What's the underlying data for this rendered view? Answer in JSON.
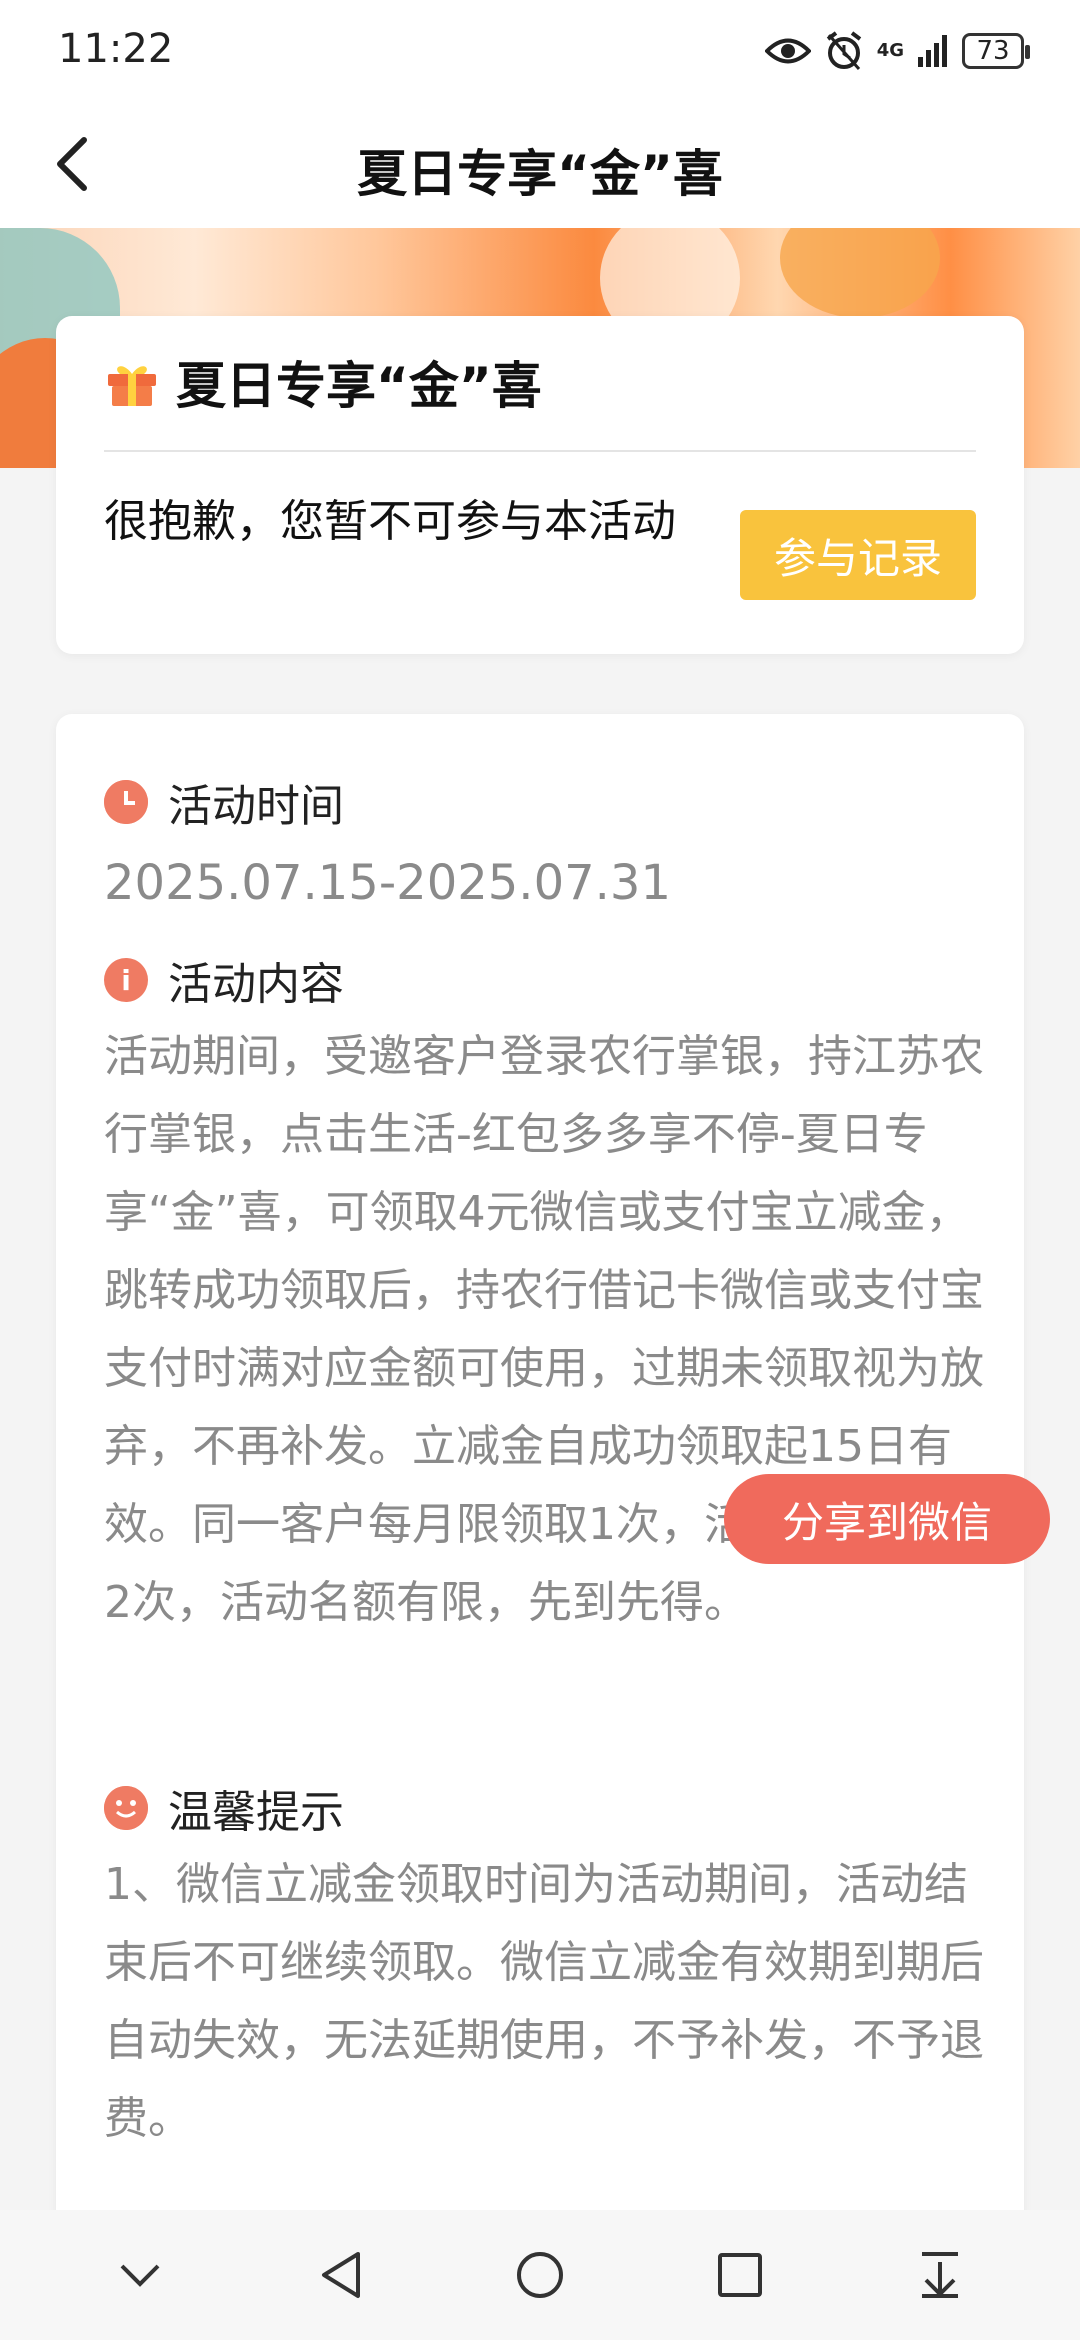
{
  "status_bar": {
    "time": "11:22",
    "network": "4G",
    "battery": "73"
  },
  "title_bar": {
    "title": "夏日专享“金”喜"
  },
  "header_card": {
    "title": "夏日专享“金”喜",
    "notice": "很抱歉，您暂不可参与本活动",
    "records_button": "参与记录"
  },
  "sections": {
    "time": {
      "heading": "活动时间",
      "content": "2025.07.15-2025.07.31"
    },
    "content": {
      "heading": "活动内容",
      "text": "活动期间，受邀客户登录农行掌银，持江苏农行掌银，点击生活-红包多多享不停-夏日专享“金”喜，可领取4元微信或支付宝立减金，跳转成功领取后，持农行借记卡微信或支付宝支付时满对应金额可使用，过期未领取视为放弃，不再补发。立减金自成功领取起15日有效。同一客户每月限领取1次，活动期内限领2次，活动名额有限，先到先得。"
    },
    "tips": {
      "heading": "温馨提示",
      "text": "1、微信立减金领取时间为活动期间，活动结束后不可继续领取。微信立减金有效期到期后自动失效，无法延期使用，不予补发，不予退费。"
    }
  },
  "share_button": "分享到微信",
  "colors": {
    "accent_orange": "#f9c33d",
    "icon_red": "#ef7b63",
    "share_red": "#f06a5c"
  }
}
